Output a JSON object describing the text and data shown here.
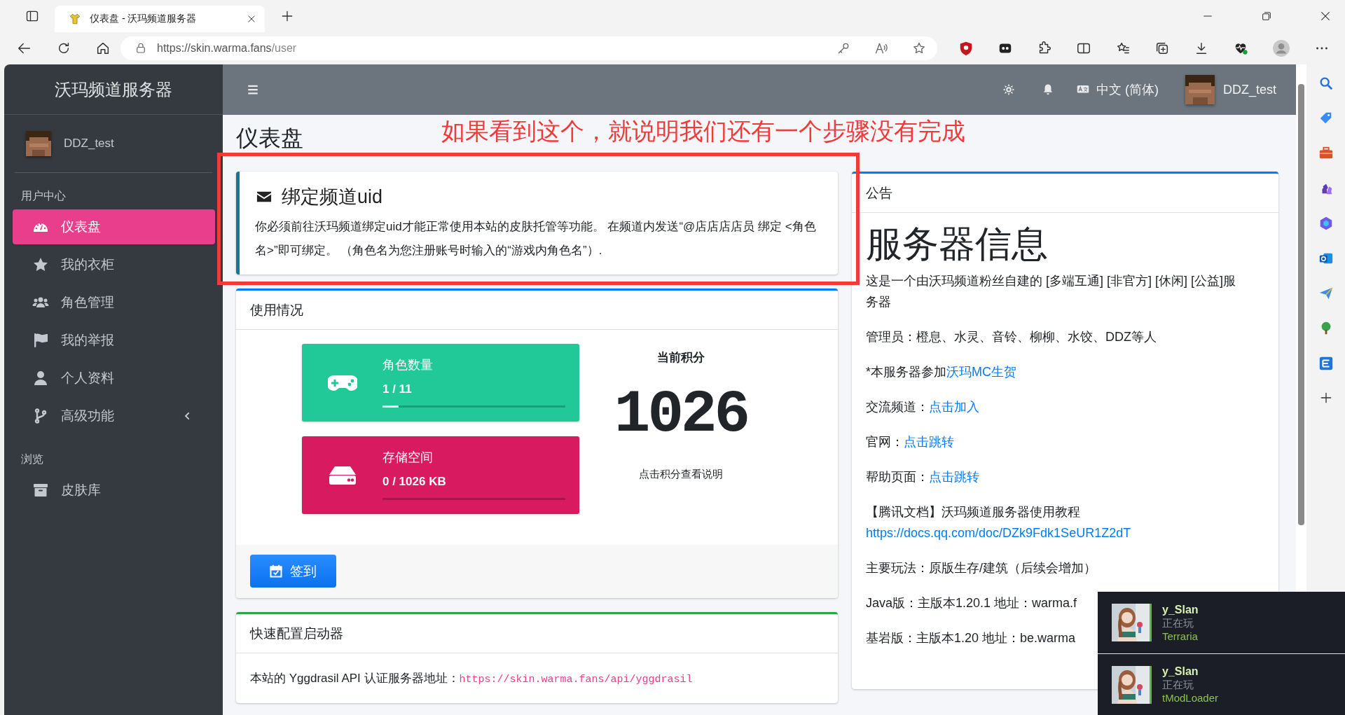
{
  "browser": {
    "tab_title": "仪表盘 - 沃玛频道服务器",
    "url_host": "https://skin.warma.fans",
    "url_path": "/user"
  },
  "sidebar": {
    "brand": "沃玛频道服务器",
    "user": "DDZ_test",
    "sections": [
      {
        "header": "用户中心",
        "items": [
          {
            "label": "仪表盘",
            "selected": true,
            "has_submenu": false
          },
          {
            "label": "我的衣柜",
            "selected": false,
            "has_submenu": false
          },
          {
            "label": "角色管理",
            "selected": false,
            "has_submenu": false
          },
          {
            "label": "我的举报",
            "selected": false,
            "has_submenu": false
          },
          {
            "label": "个人资料",
            "selected": false,
            "has_submenu": false
          },
          {
            "label": "高级功能",
            "selected": false,
            "has_submenu": true
          }
        ]
      },
      {
        "header": "浏览",
        "items": [
          {
            "label": "皮肤库",
            "selected": false,
            "has_submenu": false
          }
        ]
      }
    ]
  },
  "navbar": {
    "language": "中文 (简体)",
    "user": "DDZ_test"
  },
  "annotation": {
    "text": "如果看到这个，就说明我们还有一个步骤没有完成"
  },
  "page_title": "仪表盘",
  "bind_card": {
    "title": "绑定频道uid",
    "body": "你必须前往沃玛频道绑定uid才能正常使用本站的皮肤托管等功能。 在频道内发送“@店店店店员 绑定 <角色名>”即可绑定。  （角色名为您注册账号时输入的“游戏内角色名”）."
  },
  "usage": {
    "title": "使用情况",
    "stats": [
      {
        "label": "角色数量",
        "value": "1 / 11",
        "level": 0.09,
        "color": "#20c997"
      },
      {
        "label": "存储空间",
        "value": "0 / 1026 KB",
        "level": 0,
        "color": "#d81b60"
      }
    ],
    "score_label": "当前积分",
    "score": "1026",
    "score_hint": "点击积分查看说明",
    "checkin_button": "签到"
  },
  "quick_config": {
    "title": "快速配置启动器",
    "text": "本站的 Yggdrasil API 认证服务器地址：",
    "url": "https://skin.warma.fans/api/yggdrasil"
  },
  "announcement": {
    "title": "公告",
    "heading": "服务器信息",
    "paragraphs": [
      {
        "kind": "plain",
        "text": "这是一个由沃玛频道粉丝自建的 [多端互通] [非官方] [休闲] [公益]服务器"
      },
      {
        "kind": "plain",
        "text": "管理员：橙息、水灵、音铃、柳柳、水饺、DDZ等人"
      },
      {
        "kind": "link",
        "text": "*本服务器参加",
        "link": "沃玛MC生贺"
      },
      {
        "kind": "link",
        "text": "交流频道：",
        "link": "点击加入"
      },
      {
        "kind": "link",
        "text": "官网：",
        "link": "点击跳转"
      },
      {
        "kind": "link",
        "text": "帮助页面：",
        "link": "点击跳转"
      },
      {
        "kind": "link_below",
        "text": "【腾讯文档】沃玛频道服务器使用教程",
        "link": "https://docs.qq.com/doc/DZk9Fdk1SeUR1Z2dT"
      },
      {
        "kind": "plain",
        "text": "主要玩法：原版生存/建筑（后续会增加）"
      },
      {
        "kind": "plain",
        "text": "Java版：主版本1.20.1 地址：warma.f"
      },
      {
        "kind": "plain",
        "text": "基岩版：主版本1.20 地址：be.warma"
      }
    ]
  },
  "notifications": [
    {
      "user": "y_Slan",
      "status": "正在玩",
      "game": "Terraria"
    },
    {
      "user": "y_Slan",
      "status": "正在玩",
      "game": "tModLoader"
    }
  ]
}
